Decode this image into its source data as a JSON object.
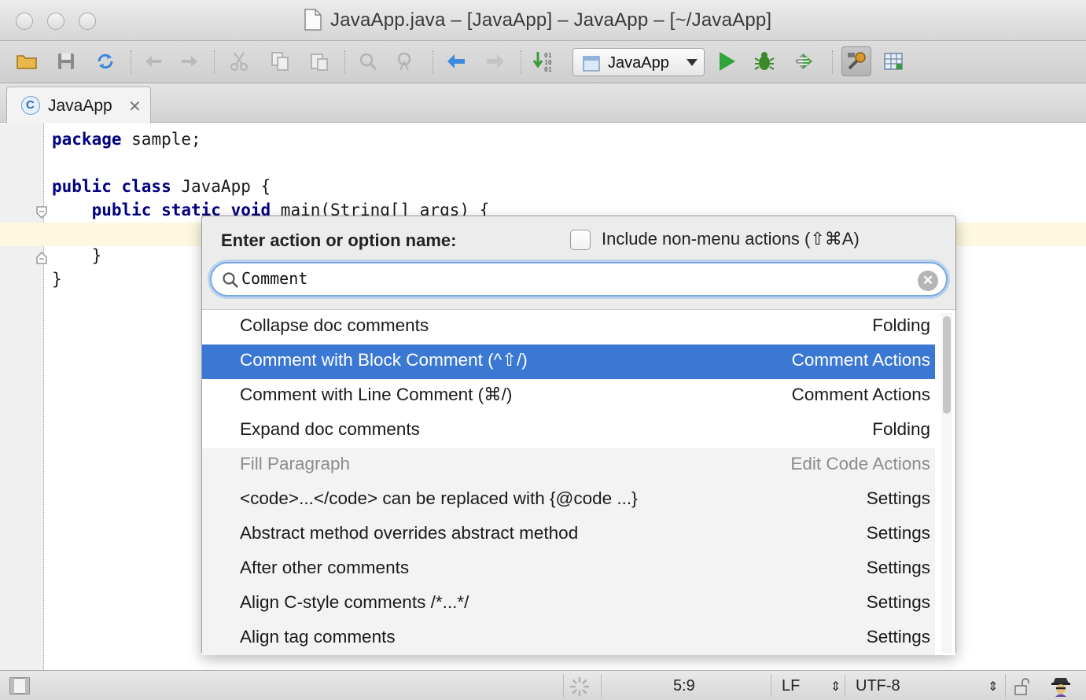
{
  "window": {
    "title": "JavaApp.java – [JavaApp] – JavaApp – [~/JavaApp]"
  },
  "toolbar": {
    "run_config": "JavaApp",
    "icons": [
      "open-folder-icon",
      "save-icon",
      "sync-icon",
      "undo-icon",
      "redo-icon",
      "cut-icon",
      "copy-icon",
      "paste-icon",
      "find-icon",
      "replace-icon",
      "back-icon",
      "forward-icon",
      "make-project-icon",
      "run-icon",
      "debug-icon",
      "coverage-icon",
      "settings-icon",
      "project-structure-icon"
    ]
  },
  "tabs": [
    {
      "label": "JavaApp",
      "icon": "class-icon",
      "icon_letter": "C",
      "active": true
    }
  ],
  "editor": {
    "lines": [
      {
        "kw": "package",
        "rest": " sample;"
      },
      {
        "kw": "public class",
        "rest": " JavaApp {"
      },
      {
        "indent": "    ",
        "kw": "public static void",
        "rest": " main(String[] args) {"
      },
      {
        "indent": "    ",
        "kw": "",
        "rest": "}"
      },
      {
        "kw": "",
        "rest": "}"
      }
    ],
    "highlight_color": "#fdf8df"
  },
  "popup": {
    "prompt": "Enter action or option name:",
    "checkbox_label": "Include non-menu actions (⇧⌘A)",
    "checkbox_checked": false,
    "search_value": "Comment",
    "results": [
      {
        "label": "Collapse doc comments",
        "group": "Folding",
        "state": "normal"
      },
      {
        "label": "Comment with Block Comment (^⇧/)",
        "group": "Comment Actions",
        "state": "selected"
      },
      {
        "label": "Comment with Line Comment (⌘/)",
        "group": "Comment Actions",
        "state": "normal"
      },
      {
        "label": "Expand doc comments",
        "group": "Folding",
        "state": "normal"
      },
      {
        "label": "Fill Paragraph",
        "group": "Edit Code Actions",
        "state": "disabled"
      },
      {
        "label": "<code>...</code> can be replaced with {@code ...}",
        "group": "Settings",
        "state": "normal"
      },
      {
        "label": "Abstract method overrides abstract method",
        "group": "Settings",
        "state": "normal"
      },
      {
        "label": "After other comments",
        "group": "Settings",
        "state": "normal"
      },
      {
        "label": "Align C-style comments /*...*/",
        "group": "Settings",
        "state": "normal"
      },
      {
        "label": "Align tag comments",
        "group": "Settings",
        "state": "normal"
      }
    ],
    "selection_color": "#3b78d4"
  },
  "statusbar": {
    "position": "5:9",
    "line_separator": "LF",
    "encoding": "UTF-8"
  }
}
